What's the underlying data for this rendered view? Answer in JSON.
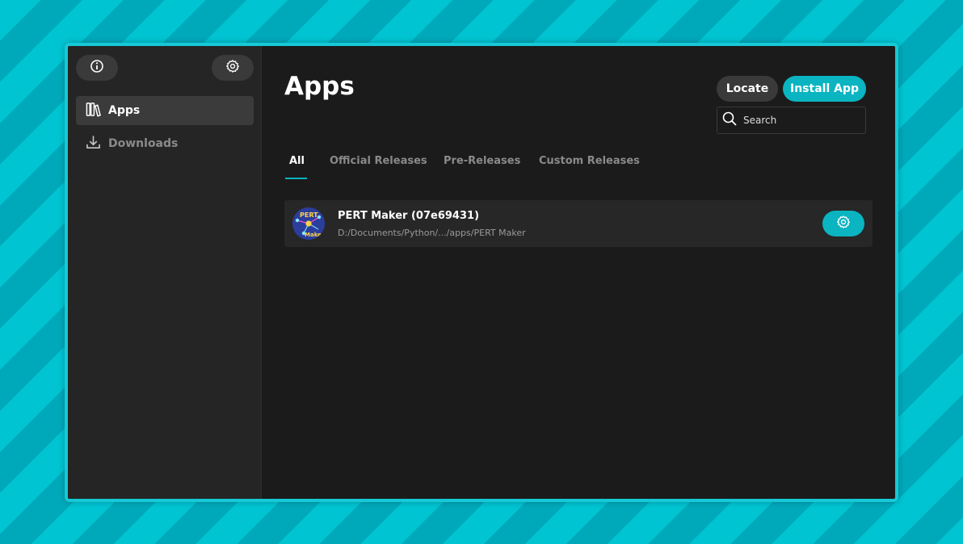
{
  "sidebar": {
    "info_button_icon": "info-icon",
    "settings_button_icon": "gear-icon",
    "items": [
      {
        "label": "Apps",
        "icon": "library-icon",
        "active": true
      },
      {
        "label": "Downloads",
        "icon": "download-icon",
        "active": false
      }
    ]
  },
  "main": {
    "title": "Apps",
    "locate_label": "Locate",
    "install_label": "Install App",
    "search_placeholder": "Search",
    "tabs": [
      {
        "label": "All",
        "active": true
      },
      {
        "label": "Official Releases",
        "active": false
      },
      {
        "label": "Pre-Releases",
        "active": false
      },
      {
        "label": "Custom Releases",
        "active": false
      }
    ],
    "apps": [
      {
        "name": "PERT Maker (07e69431)",
        "path": "D:/Documents/Python/.../apps/PERT Maker",
        "icon_text_top": "PERT",
        "icon_text_bottom": "Maker"
      }
    ]
  },
  "colors": {
    "accent": "#0ab4c1",
    "background_stripe_1": "#00c4d2",
    "background_stripe_2": "#00a9ba",
    "window_bg": "#1b1b1b",
    "sidebar_bg": "#252525"
  }
}
